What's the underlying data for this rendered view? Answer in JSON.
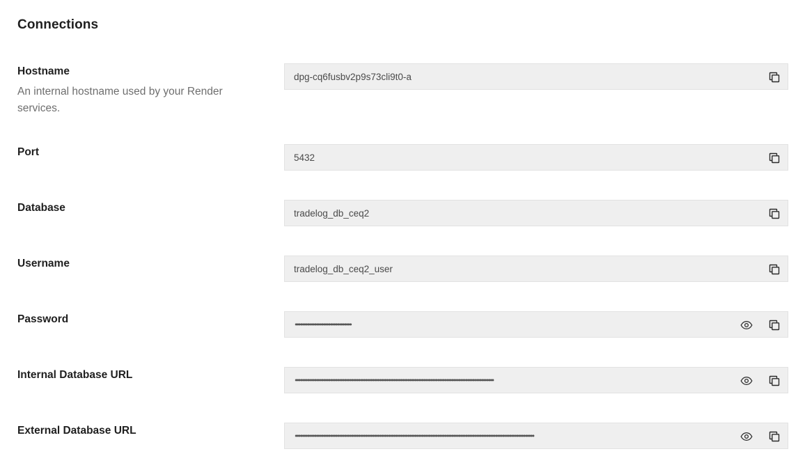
{
  "section": {
    "title": "Connections"
  },
  "fields": [
    {
      "id": "hostname",
      "label": "Hostname",
      "description": "An internal hostname used by your Render services.",
      "value": "dpg-cq6fusbv2p9s73cli9t0-a",
      "masked": false,
      "icons": [
        "copy-icon"
      ]
    },
    {
      "id": "port",
      "label": "Port",
      "value": "5432",
      "masked": false,
      "icons": [
        "copy-icon"
      ]
    },
    {
      "id": "database",
      "label": "Database",
      "value": "tradelog_db_ceq2",
      "masked": false,
      "icons": [
        "copy-icon"
      ]
    },
    {
      "id": "username",
      "label": "Username",
      "value": "tradelog_db_ceq2_user",
      "masked": false,
      "icons": [
        "copy-icon"
      ]
    },
    {
      "id": "password",
      "label": "Password",
      "value": "••••••••••••••••••••••••••••••••",
      "masked": true,
      "icons": [
        "eye-icon",
        "copy-icon"
      ]
    },
    {
      "id": "internal-database-url",
      "label": "Internal Database URL",
      "value": "•••••••••••••••••••••••••••••••••••••••••••••••••••••••••••••••••••••••••••••••••••••••••••••••••••••••••••••••••",
      "masked": true,
      "icons": [
        "eye-icon",
        "copy-icon"
      ]
    },
    {
      "id": "external-database-url",
      "label": "External Database URL",
      "value": "••••••••••••••••••••••••••••••••••••••••••••••••••••••••••••••••••••••••••••••••••••••••••••••••••••••••••••••••••••••••••••••••••••••••",
      "masked": true,
      "icons": [
        "eye-icon",
        "copy-icon"
      ]
    }
  ]
}
